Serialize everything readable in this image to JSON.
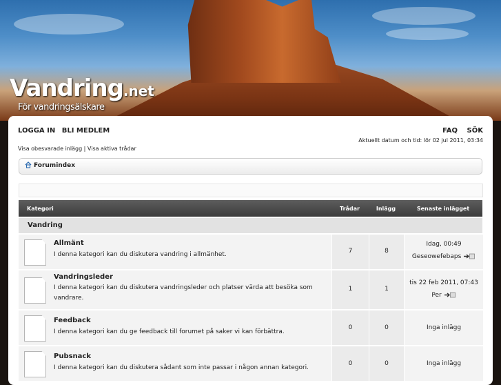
{
  "banner": {
    "logo_main": "Vandring",
    "logo_net": ".net",
    "logo_sub": "För vandringsälskare"
  },
  "nav": {
    "login": "LOGGA IN",
    "register": "BLI MEDLEM",
    "faq": "FAQ",
    "search": "SÖK"
  },
  "datetime": "Aktuellt datum och tid: lör 02 jul 2011, 03:34",
  "links": {
    "unanswered": "Visa obesvarade inlägg",
    "sep": " | ",
    "active": "Visa aktiva trådar"
  },
  "breadcrumb": {
    "label": "Forumindex"
  },
  "table": {
    "headers": {
      "category": "Kategori",
      "threads": "Trådar",
      "posts": "Inlägg",
      "latest": "Senaste inlägget"
    },
    "section": "Vandring",
    "forums": [
      {
        "title": "Allmänt",
        "desc": "I denna kategori kan du diskutera vandring i allmänhet.",
        "threads": "7",
        "posts": "8",
        "last_line1": "Idag, 00:49",
        "last_line2": "Geseowefebaps"
      },
      {
        "title": "Vandringsleder",
        "desc": "I denna kategori kan du diskutera vandringsleder och platser värda att besöka som vandrare.",
        "threads": "1",
        "posts": "1",
        "last_line1": "tis 22 feb 2011, 07:43",
        "last_line2": "Per"
      },
      {
        "title": "Feedback",
        "desc": "I denna kategori kan du ge feedback till forumet på saker vi kan förbättra.",
        "threads": "0",
        "posts": "0",
        "last_line1": "Inga inlägg",
        "last_line2": ""
      },
      {
        "title": "Pubsnack",
        "desc": "I denna kategori kan du diskutera sådant som inte passar i någon annan kategori.",
        "threads": "0",
        "posts": "0",
        "last_line1": "Inga inlägg",
        "last_line2": ""
      }
    ]
  }
}
